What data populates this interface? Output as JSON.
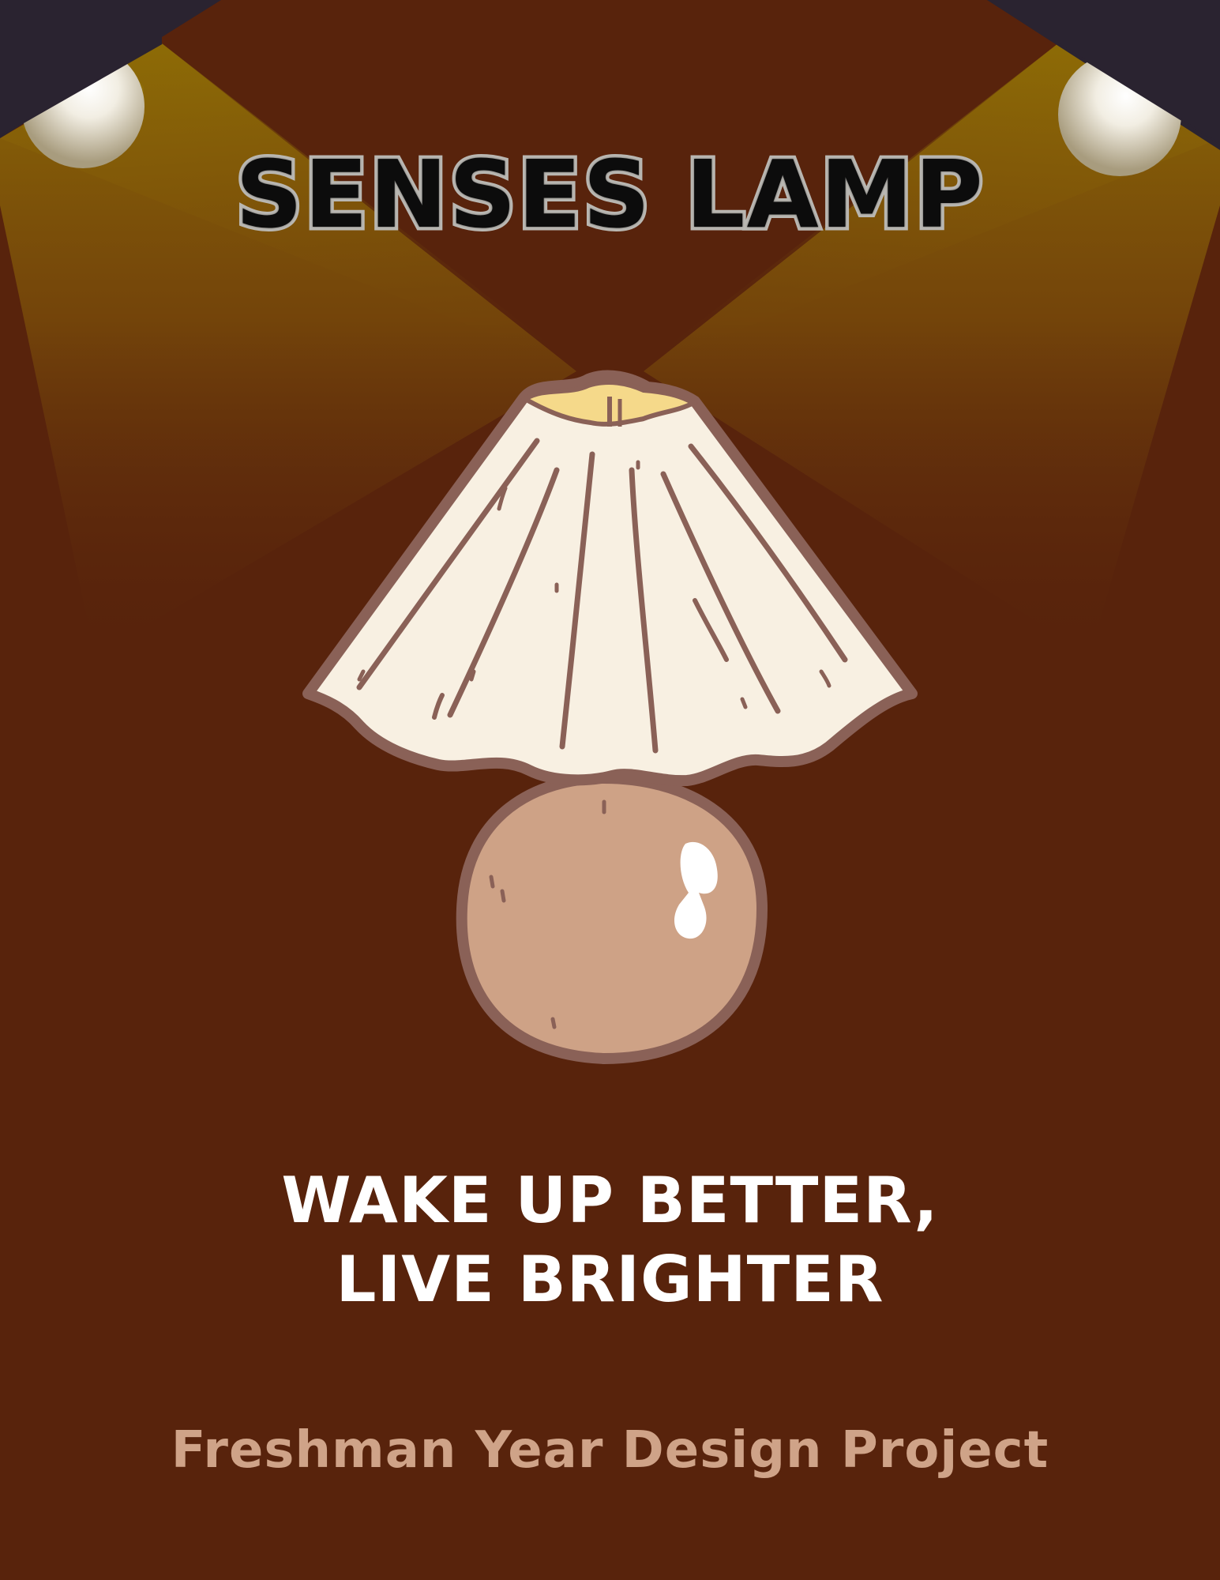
{
  "poster": {
    "title": "SENSES LAMP",
    "tagline": {
      "line1": "WAKE UP BETTER,",
      "line2": "LIVE BRIGHTER"
    },
    "credit": "Freshman Year Design Project"
  },
  "colors": {
    "background": "#58230c",
    "corner_dark": "#2a2330",
    "spotlight_beam": "#8e6c06",
    "title_fill": "#0c0c0c",
    "title_outline": "#b9b7b2",
    "tagline": "#ffffff",
    "credit": "#cfa388",
    "lampshade": "#f8f0e2",
    "lamp_base": "#cea286",
    "lamp_outline": "#8a6157"
  },
  "icons": [
    "spotlight-left-icon",
    "spotlight-right-icon",
    "lamp-illustration"
  ]
}
